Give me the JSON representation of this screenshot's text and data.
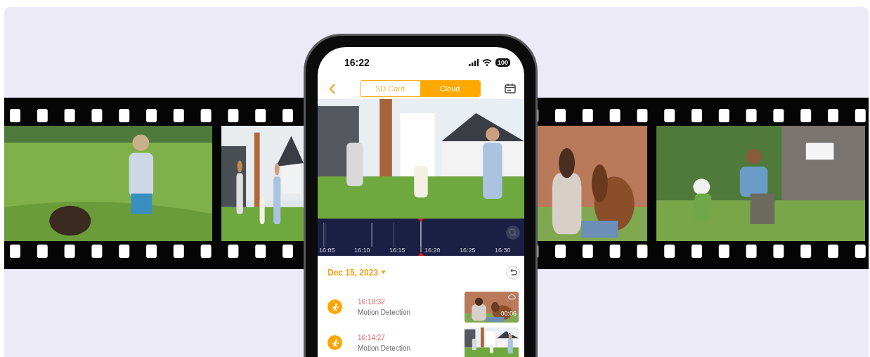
{
  "phone": {
    "status_bar": {
      "time": "16:22",
      "battery": "100"
    },
    "tabs": [
      {
        "label": "SD Card",
        "selected": false
      },
      {
        "label": "Cloud",
        "selected": true
      }
    ],
    "timeline": {
      "ticks": [
        "16:05",
        "16:10",
        "16:15",
        "16:20",
        "16:25",
        "16:30"
      ],
      "level": 0.5
    },
    "date": "Dec 15, 2023",
    "events": [
      {
        "time": "16:18:32",
        "label": "Motion Detection",
        "duration": "00:06"
      },
      {
        "time": "16:14:27",
        "label": "Motion Detection"
      }
    ]
  }
}
